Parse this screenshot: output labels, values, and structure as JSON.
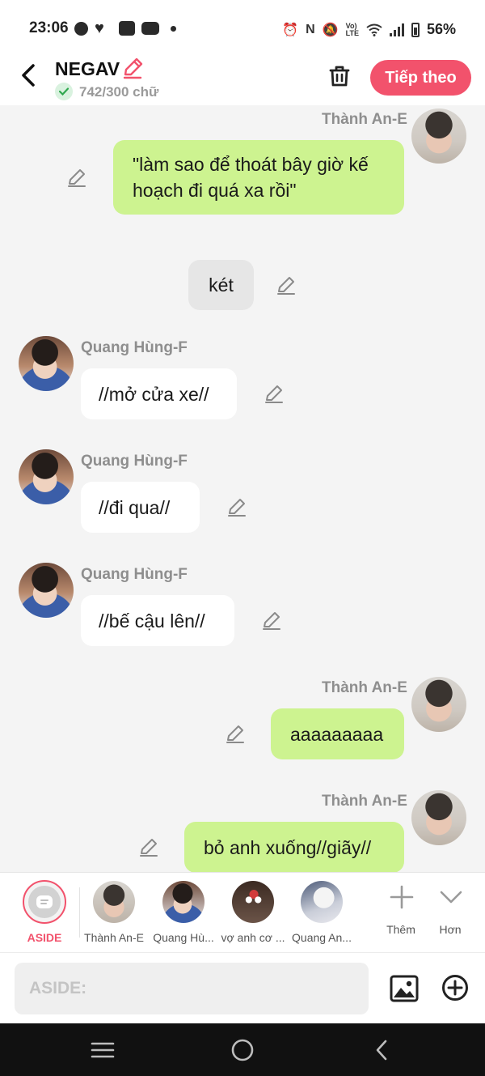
{
  "status_bar": {
    "time": "23:06",
    "battery": "56%",
    "left_icons": [
      "facebook-icon",
      "heart-app-icon",
      "message-icon",
      "youtube-icon",
      "dot-icon"
    ],
    "right_icons": [
      "alarm-icon",
      "nfc-icon",
      "mute-icon",
      "volte-icon",
      "wifi-icon",
      "signal-icon",
      "battery-icon"
    ]
  },
  "header": {
    "title": "NEGAV",
    "word_count": "742/300 chữ",
    "next_label": "Tiếp theo",
    "accent_color": "#f2526c"
  },
  "messages": [
    {
      "side": "right",
      "sender": "Thành An-E",
      "text": "\"làm sao để thoát bây giờ kế hoạch đi quá xa rồi\""
    },
    {
      "side": "center",
      "sender": "",
      "text": "két"
    },
    {
      "side": "left",
      "sender": "Quang Hùng-F",
      "text": "//mở cửa xe//"
    },
    {
      "side": "left",
      "sender": "Quang Hùng-F",
      "text": "//đi qua//"
    },
    {
      "side": "left",
      "sender": "Quang Hùng-F",
      "text": "//bế cậu lên//"
    },
    {
      "side": "right",
      "sender": "Thành An-E",
      "text": "aaaaaaaaa"
    },
    {
      "side": "right",
      "sender": "Thành An-E",
      "text": "bỏ anh xuống//giãy//"
    }
  ],
  "character_bar": {
    "aside_label": "ASIDE",
    "characters": [
      {
        "label": "Thành An-E"
      },
      {
        "label": "Quang Hù..."
      },
      {
        "label": "vợ anh cơ ..."
      },
      {
        "label": "Quang An..."
      }
    ],
    "add_label": "Thêm",
    "more_label": "Hơn"
  },
  "input": {
    "placeholder": "ASIDE:",
    "value": ""
  },
  "colors": {
    "right_bubble": "#cdf390",
    "left_bubble": "#ffffff",
    "narration_bubble": "#e6e6e6"
  }
}
